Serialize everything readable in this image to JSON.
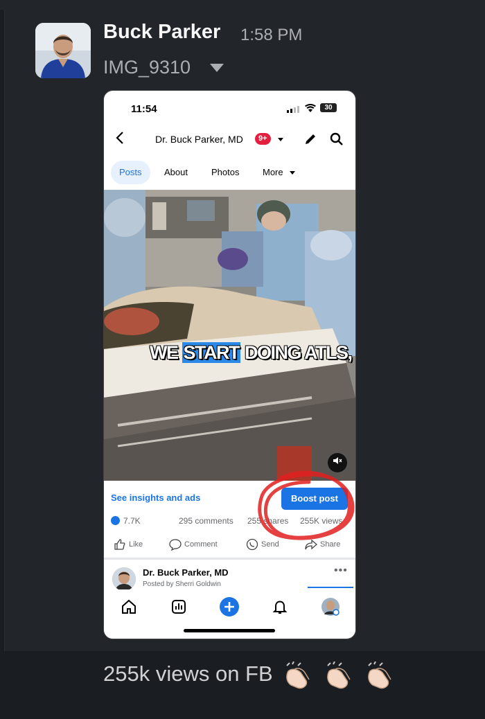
{
  "message": {
    "author": "Buck Parker",
    "time": "1:58 PM",
    "filename": "IMG_9310",
    "text": "255k views on FB",
    "reaction_emoji_icon": "clapping-hands-icon"
  },
  "phone": {
    "status_time": "11:54",
    "battery": "30",
    "page_title": "Dr. Buck Parker, MD",
    "notification_badge": "9+",
    "tabs": [
      "Posts",
      "About",
      "Photos",
      "More"
    ],
    "video_caption_parts": [
      "WE ",
      "START",
      " DOING ATLS,"
    ],
    "insights_link": "See insights and ads",
    "boost_button": "Boost post",
    "stats": {
      "likes": "7.7K",
      "comments": "295 comments",
      "shares": "255 shares",
      "views": "255K views"
    },
    "actions": [
      "Like",
      "Comment",
      "Send",
      "Share"
    ],
    "next_post": {
      "author": "Dr. Buck Parker, MD",
      "subtitle": "Posted by Sherri Goldwin"
    }
  },
  "colors": {
    "facebook_blue": "#1b74e4",
    "badge_red": "#e41e3f",
    "annotation_red": "#e0201f",
    "slack_bg": "#222529"
  }
}
